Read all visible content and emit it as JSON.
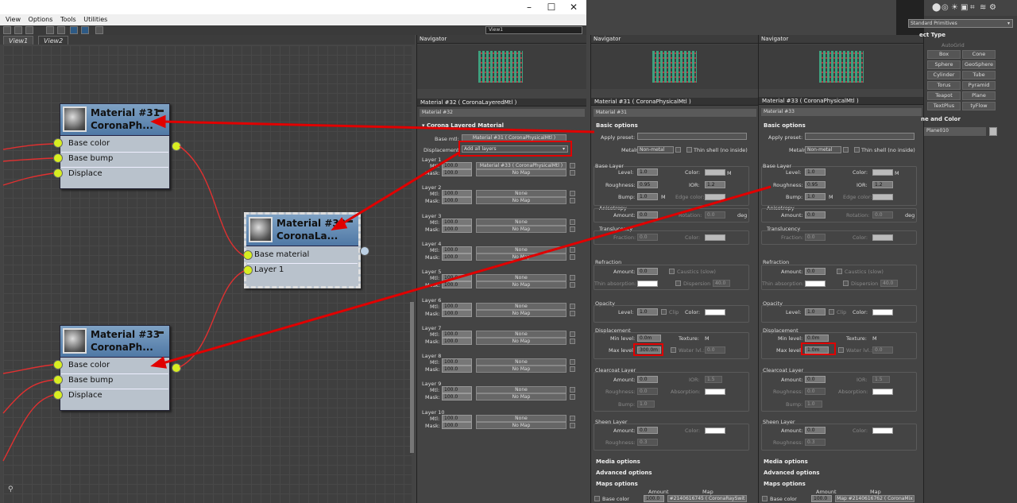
{
  "menu": [
    "View",
    "Options",
    "Tools",
    "Utilities"
  ],
  "view_dropdown": "View1",
  "tabs": [
    "View1",
    "View2"
  ],
  "nodes": {
    "n31": {
      "title1": "Material #31",
      "title2": "CoronaPh...",
      "slots": [
        "Base color",
        "Base bump",
        "Displace"
      ]
    },
    "n32": {
      "title1": "Material #32",
      "title2": "CoronaLa...",
      "slots": [
        "Base material",
        "Layer 1"
      ]
    },
    "n33": {
      "title1": "Material #33",
      "title2": "CoronaPh...",
      "slots": [
        "Base color",
        "Base bump",
        "Displace"
      ]
    }
  },
  "navigator": "Navigator",
  "layered": {
    "header": "Material #32  ( CoronaLayeredMtl )",
    "name": "Material #32",
    "section": "Corona Layered Material",
    "base_mtl_label": "Base mtl:",
    "base_mtl": "Material #31  ( CoronaPhysicalMtl )",
    "disp_label": "Displacement:",
    "disp_value": "Add all layers",
    "mtl_label": "Mtl:",
    "mask_label": "Mask:",
    "layers": [
      {
        "name": "Layer 1",
        "mv": "100.0",
        "mtl": "Material #33  ( CoronaPhysicalMtl )",
        "kv": "100.0",
        "mask": "No Map"
      },
      {
        "name": "Layer 2",
        "mv": "100.0",
        "mtl": "None",
        "kv": "100.0",
        "mask": "No Map"
      },
      {
        "name": "Layer 3",
        "mv": "100.0",
        "mtl": "None",
        "kv": "100.0",
        "mask": "No Map"
      },
      {
        "name": "Layer 4",
        "mv": "100.0",
        "mtl": "None",
        "kv": "100.0",
        "mask": "No Map"
      },
      {
        "name": "Layer 5",
        "mv": "100.0",
        "mtl": "None",
        "kv": "100.0",
        "mask": "No Map"
      },
      {
        "name": "Layer 6",
        "mv": "100.0",
        "mtl": "None",
        "kv": "100.0",
        "mask": "No Map"
      },
      {
        "name": "Layer 7",
        "mv": "100.0",
        "mtl": "None",
        "kv": "100.0",
        "mask": "No Map"
      },
      {
        "name": "Layer 8",
        "mv": "100.0",
        "mtl": "None",
        "kv": "100.0",
        "mask": "No Map"
      },
      {
        "name": "Layer 9",
        "mv": "100.0",
        "mtl": "None",
        "kv": "100.0",
        "mask": "No Map"
      },
      {
        "name": "Layer 10",
        "mv": "100.0",
        "mtl": "None",
        "kv": "100.0",
        "mask": "No Map"
      }
    ]
  },
  "phys31": {
    "header": "Material #31  ( CoronaPhysicalMtl )",
    "name": "Material #31",
    "max_level": "300.0m",
    "map_amount": "100.0",
    "map": "#2140616745  ( CoronaRaySwit"
  },
  "phys33": {
    "header": "Material #33  ( CoronaPhysicalMtl )",
    "name": "Material #33",
    "max_level": "1.0m",
    "map_amount": "100.0",
    "map": "Map #2140616762  ( CoronaMix"
  },
  "phys_labels": {
    "basic": "Basic options",
    "apply_preset": "Apply preset:",
    "metalness": "Metalness:",
    "metal_val": "Non-metal",
    "thin_shell": "Thin shell (no inside)",
    "base_layer": "Base Layer",
    "level": "Level:",
    "level_val": "1.0",
    "color": "Color:",
    "roughness": "Roughness:",
    "rough_val": "0.95",
    "ior": "IOR:",
    "ior_val": "1.2",
    "bump": "Bump:",
    "bump_val": "1.0",
    "m": "M",
    "edge": "Edge color:",
    "aniso": "Anisotropy",
    "amount": "Amount:",
    "zero": "0.0",
    "rotation": "Rotation:",
    "deg": "deg",
    "transl": "Translucency",
    "fraction": "Fraction:",
    "refraction": "Refraction",
    "caustics": "Caustics (slow)",
    "thin_abs": "Thin absorption:",
    "dispersion": "Dispersion",
    "disp_val": "40.0",
    "opacity": "Opacity",
    "clip": "Clip",
    "displacement": "Displacement",
    "min_level": "Min level:",
    "min_val": "0.0m",
    "texture": "Texture:",
    "max_level": "Max level:",
    "water": "Water lvl.:",
    "clearcoat": "Clearcoat Layer",
    "cc_ior": "1.5",
    "absorption": "Absorption:",
    "sheen": "Sheen Layer",
    "sheen_rough": "0.3",
    "media": "Media options",
    "advanced": "Advanced options",
    "maps": "Maps options",
    "amount_h": "Amount",
    "map_h": "Map",
    "base_color": "Base color"
  },
  "cmd": {
    "dropdown": "Standard Primitives",
    "object_type": "ect Type",
    "autogrid": "AutoGrid",
    "buttons": [
      "Box",
      "Cone",
      "Sphere",
      "GeoSphere",
      "Cylinder",
      "Tube",
      "Torus",
      "Pyramid",
      "Teapot",
      "Plane",
      "TextPlus",
      "tyFlow"
    ],
    "name_color": "ne and Color",
    "name": "Plane010"
  }
}
